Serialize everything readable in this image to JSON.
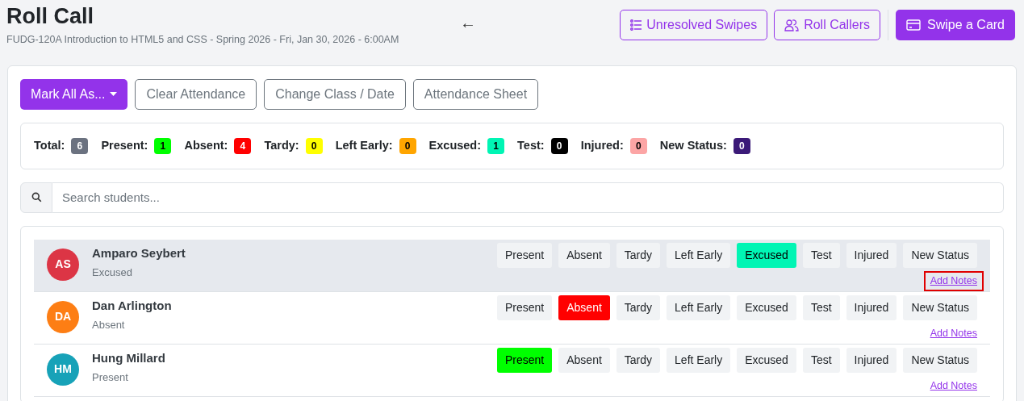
{
  "header": {
    "title": "Roll Call",
    "subtitle": "FUDG-120A Introduction to HTML5 and CSS - Spring 2026 - Fri, Jan 30, 2026 - 6:00AM",
    "back": "←"
  },
  "header_buttons": [
    {
      "kind": "list",
      "label": "Unresolved Swipes"
    },
    {
      "kind": "people",
      "label": "Roll Callers"
    },
    {
      "kind": "card",
      "label": "Swipe a Card"
    }
  ],
  "toolbar": [
    {
      "kind": "dropdown",
      "label": "Mark All As..."
    },
    {
      "kind": "plain",
      "label": "Clear Attendance"
    },
    {
      "kind": "plain",
      "label": "Change Class / Date"
    },
    {
      "kind": "plain",
      "label": "Attendance Sheet"
    }
  ],
  "totals": [
    {
      "label": "Total:",
      "count": "6",
      "color": "#6b7280"
    },
    {
      "label": "Present:",
      "count": "1",
      "color": "#00ff00"
    },
    {
      "label": "Absent:",
      "count": "4",
      "color": "#ff0000"
    },
    {
      "label": "Tardy:",
      "count": "0",
      "color": "#ffff00"
    },
    {
      "label": "Left Early:",
      "count": "0",
      "color": "#ffa500"
    },
    {
      "label": "Excused:",
      "count": "1",
      "color": "#00f5b4"
    },
    {
      "label": "Test:",
      "count": "0",
      "color": "#000000"
    },
    {
      "label": "Injured:",
      "count": "0",
      "color": "#fca5a5"
    },
    {
      "label": "New Status:",
      "count": "0",
      "color": "#3b1a78"
    }
  ],
  "search": {
    "placeholder": "Search students..."
  },
  "students": [
    {
      "initials": "AS",
      "name": "Amparo Seybert",
      "status": "Excused",
      "color": "#dc3545",
      "hovered": true,
      "notes": "Add Notes",
      "notes_highlighted": true,
      "options": [
        {
          "label": "Present",
          "selected": false
        },
        {
          "label": "Absent",
          "selected": false
        },
        {
          "label": "Tardy",
          "selected": false
        },
        {
          "label": "Left Early",
          "selected": false
        },
        {
          "label": "Excused",
          "selected": true,
          "color": "#00f5b4"
        },
        {
          "label": "Test",
          "selected": false
        },
        {
          "label": "Injured",
          "selected": false
        },
        {
          "label": "New Status",
          "selected": false
        }
      ]
    },
    {
      "initials": "DA",
      "name": "Dan Arlington",
      "status": "Absent",
      "color": "#fd7e14",
      "hovered": false,
      "notes": "Add Notes",
      "notes_highlighted": false,
      "options": [
        {
          "label": "Present",
          "selected": false
        },
        {
          "label": "Absent",
          "selected": true,
          "color": "#ff0000"
        },
        {
          "label": "Tardy",
          "selected": false
        },
        {
          "label": "Left Early",
          "selected": false
        },
        {
          "label": "Excused",
          "selected": false
        },
        {
          "label": "Test",
          "selected": false
        },
        {
          "label": "Injured",
          "selected": false
        },
        {
          "label": "New Status",
          "selected": false
        }
      ]
    },
    {
      "initials": "HM",
      "name": "Hung Millard",
      "status": "Present",
      "color": "#17a2b8",
      "hovered": false,
      "notes": "Add Notes",
      "notes_highlighted": false,
      "options": [
        {
          "label": "Present",
          "selected": true,
          "color": "#00ff00"
        },
        {
          "label": "Absent",
          "selected": false
        },
        {
          "label": "Tardy",
          "selected": false
        },
        {
          "label": "Left Early",
          "selected": false
        },
        {
          "label": "Excused",
          "selected": false
        },
        {
          "label": "Test",
          "selected": false
        },
        {
          "label": "Injured",
          "selected": false
        },
        {
          "label": "New Status",
          "selected": false
        }
      ]
    }
  ]
}
